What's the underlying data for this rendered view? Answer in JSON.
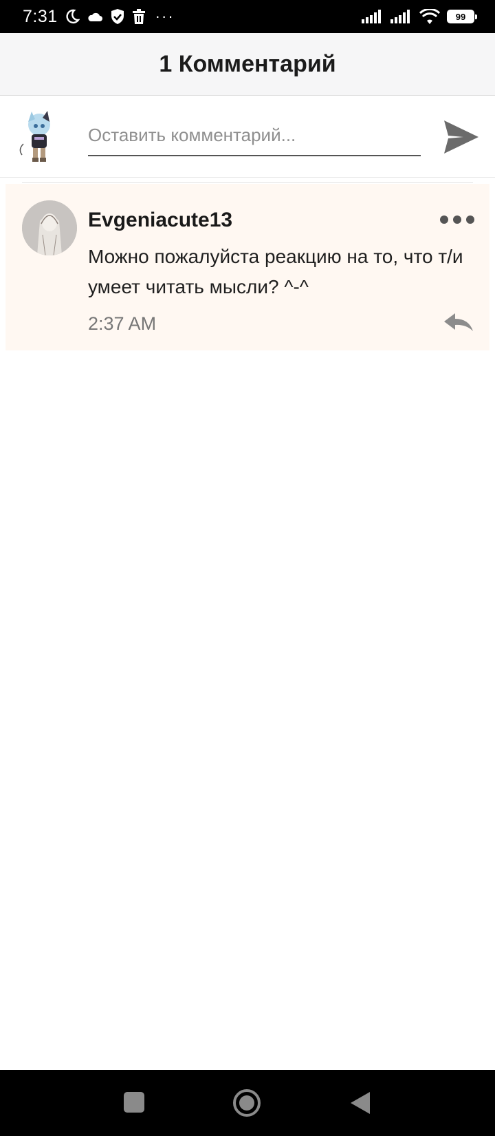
{
  "status_bar": {
    "time": "7:31",
    "battery": "99",
    "icons": [
      "moon-icon",
      "cloud-icon",
      "shield-icon",
      "trash-icon",
      "signal-icon",
      "signal-icon",
      "wifi-icon",
      "battery-icon"
    ]
  },
  "header": {
    "title": "1 Комментарий"
  },
  "composer": {
    "placeholder": "Оставить комментарий...",
    "value": ""
  },
  "comments": [
    {
      "author": "Evgeniacute13",
      "text": "Можно пожалуйста реакцию на то, что т/и умеет читать мысли? ^-^",
      "time": "2:37 AM"
    }
  ],
  "colors": {
    "header_bg": "#f6f6f7",
    "comment_bg": "#fff8f2",
    "icon_gray": "#6b6b6b"
  }
}
